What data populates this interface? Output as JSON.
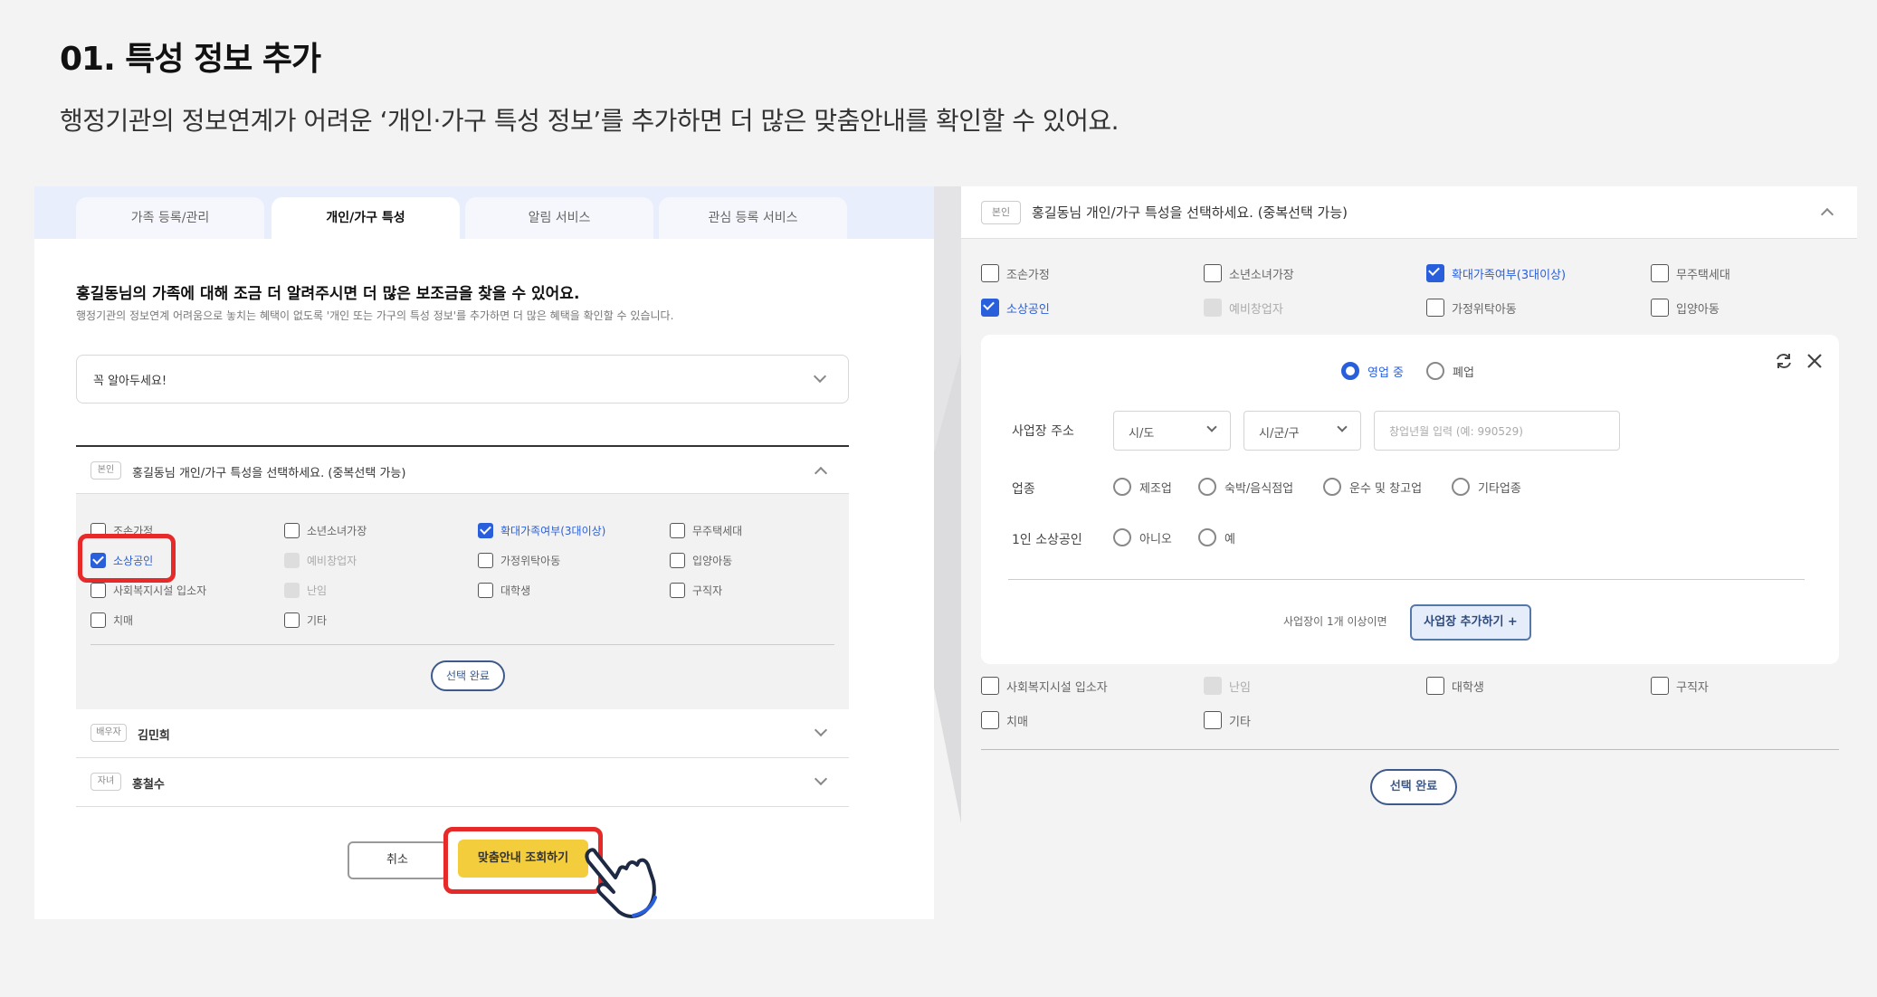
{
  "heading": "01. 특성 정보 추가",
  "description": "행정기관의 정보연계가 어려운 ‘개인·가구 특성 정보’를 추가하면 더 많은 맞춤안내를 확인할 수 있어요.",
  "left": {
    "tabs": [
      "가족 등록/관리",
      "개인/가구 특성",
      "알림 서비스",
      "관심 등록 서비스"
    ],
    "title": "홍길동님의 가족에 대해 조금 더 알려주시면 더 많은 보조금을 찾을 수 있어요.",
    "subtitle": "행정기관의 정보연계 어려움으로 놓치는 혜택이 없도록 '개인 또는 가구의 특성 정보'를 추가하면 더 많은 혜택을 확인할 수 있습니다.",
    "notice": "꼭 알아두세요!",
    "self_badge": "본인",
    "self_title": "홍길동님 개인/가구 특성을 선택하세요. (중복선택 가능)",
    "items": [
      "조손가정",
      "소년소녀가장",
      "확대가족여부(3대이상)",
      "무주택세대",
      "소상공인",
      "예비창업자",
      "가정위탁아동",
      "입양아동",
      "사회복지시설 입소자",
      "난임",
      "대학생",
      "구직자",
      "치매",
      "기타"
    ],
    "done_button": "선택 완료",
    "spouse_badge": "배우자",
    "spouse_name": "김민희",
    "child_badge": "자녀",
    "child_name": "홍철수",
    "cancel_button": "취소",
    "confirm_button": "맞춤안내 조회하기"
  },
  "right": {
    "badge": "본인",
    "title": "홍길동님 개인/가구 특성을 선택하세요. (중복선택 가능)",
    "items_top": [
      "조손가정",
      "소년소녀가장",
      "확대가족여부(3대이상)",
      "무주택세대",
      "소상공인",
      "예비창업자",
      "가정위탁아동",
      "입양아동"
    ],
    "status_options": [
      "영업 중",
      "폐업"
    ],
    "address_label": "사업장 주소",
    "sido_placeholder": "시/도",
    "sigungu_placeholder": "시/군/구",
    "founding_placeholder": "창업년월 입력 (예: 990529)",
    "industry_label": "업종",
    "industry_options": [
      "제조업",
      "숙박/음식점업",
      "운수 및 창고업",
      "기타업종"
    ],
    "solo_label": "1인 소상공인",
    "solo_options": [
      "아니오",
      "예"
    ],
    "multi_text": "사업장이 1개 이상이면",
    "add_button": "사업장 추가하기 +",
    "items_bottom": [
      "사회복지시설 입소자",
      "난임",
      "대학생",
      "구직자",
      "치매",
      "기타"
    ],
    "done_button": "선택 완료"
  },
  "colors": {
    "accent": "#2a5fdb",
    "highlight": "#e62a2a",
    "confirm": "#f4cd3d"
  }
}
